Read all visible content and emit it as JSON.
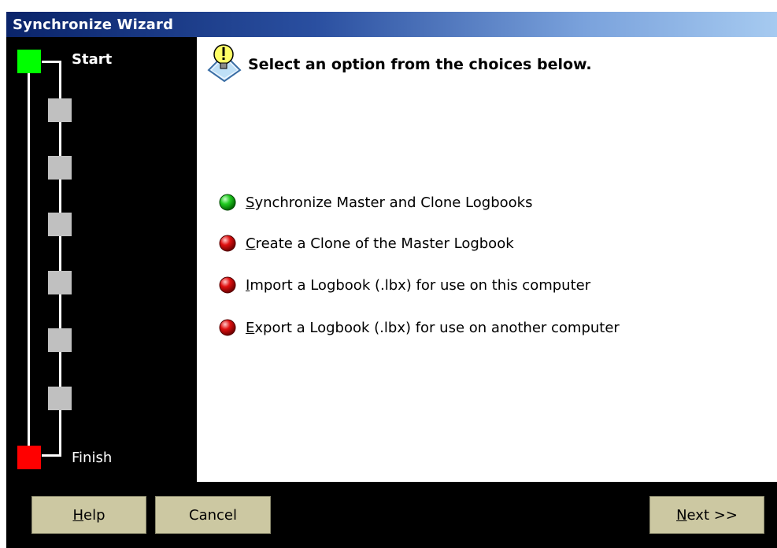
{
  "window": {
    "title": "Synchronize Wizard"
  },
  "steps": {
    "start_label": "Start",
    "finish_label": "Finish"
  },
  "main": {
    "heading": "Select an option from the choices below.",
    "options": [
      {
        "mnemonic": "S",
        "rest": "ynchronize Master and Clone Logbooks",
        "status": "green"
      },
      {
        "mnemonic": "C",
        "rest": "reate a Clone of the Master Logbook",
        "status": "red"
      },
      {
        "mnemonic": "I",
        "rest": "mport a Logbook (.lbx) for use on this computer",
        "status": "red"
      },
      {
        "mnemonic": "E",
        "rest": "xport a Logbook (.lbx) for use on another computer",
        "status": "red"
      }
    ]
  },
  "buttons": {
    "help": {
      "mnemonic": "H",
      "rest": "elp"
    },
    "cancel": {
      "label": "Cancel"
    },
    "next": {
      "mnemonic": "N",
      "rest": "ext >>"
    }
  },
  "colors": {
    "start_step": "#00ff00",
    "finish_step": "#ff0000",
    "pending_step": "#c0c0c0",
    "button_face": "#ccc8a2"
  },
  "icons": {
    "heading_icon": "lightbulb-hint-icon",
    "option_active_icon": "green-ball-icon",
    "option_inactive_icon": "red-ball-icon"
  }
}
